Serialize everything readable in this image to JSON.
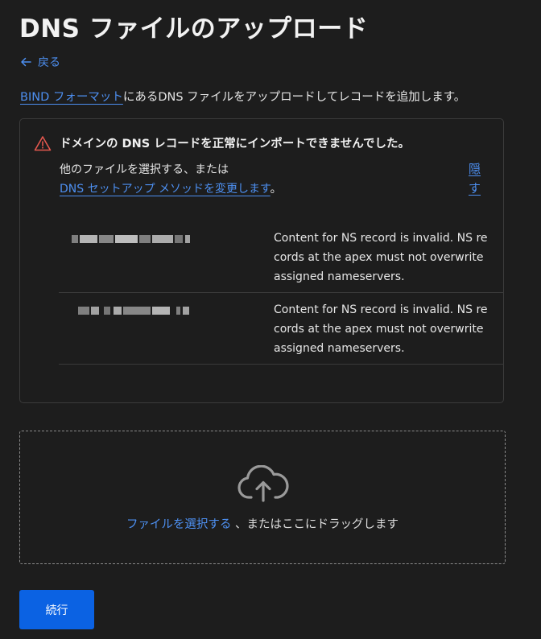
{
  "header": {
    "title": "DNS ファイルのアップロード",
    "back_label": "戻る"
  },
  "intro": {
    "link_text": "BIND フォーマット",
    "rest_text": "にあるDNS ファイルをアップロードしてレコードを追加します。"
  },
  "error": {
    "title": "ドメインの DNS レコードを正常にインポートできませんでした。",
    "line1": "他のファイルを選択する、または",
    "link_text": "DNS セットアップ メソッドを変更します",
    "line2_suffix": "。",
    "hide_label": "隠す",
    "rows": [
      {
        "message": "Content for NS record is invalid. NS records at the apex must not overwrite assigned nameservers."
      },
      {
        "message": "Content for NS record is invalid. NS records at the apex must not overwrite assigned nameservers."
      }
    ]
  },
  "dropzone": {
    "link_text": "ファイルを選択する",
    "rest_text": " 、またはここにドラッグします"
  },
  "footer": {
    "continue_label": "続行"
  },
  "icons": {
    "back": "arrow-left-icon",
    "warning": "warning-triangle-icon",
    "upload": "cloud-upload-icon"
  },
  "colors": {
    "accent": "#4d8ff0",
    "primary_button": "#0b62e3",
    "warning": "#e5584f",
    "background": "#1d1d1d"
  }
}
